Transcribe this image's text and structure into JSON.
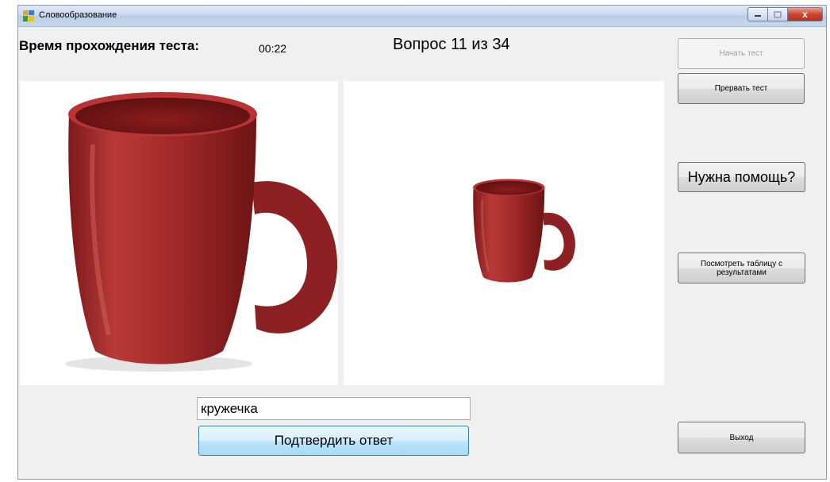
{
  "window": {
    "title": "Словообразование",
    "close_glyph": "x"
  },
  "header": {
    "time_label": "Время прохождения теста:",
    "timer": "00:22",
    "question": "Вопрос 11 из 34"
  },
  "sidebar": {
    "start_label": "Начать тест",
    "stop_label": "Прервать тест",
    "help_label": "Нужна помощь?",
    "results_label": "Посмотреть таблицу с результатами",
    "exit_label": "Выход"
  },
  "answer": {
    "value": "кружечка",
    "submit_label": "Подтвердить ответ"
  },
  "images": {
    "left": "red-mug-large",
    "right": "red-mug-small"
  },
  "colors": {
    "mug": "#a32a2a",
    "accent": "#3c7fb1"
  }
}
